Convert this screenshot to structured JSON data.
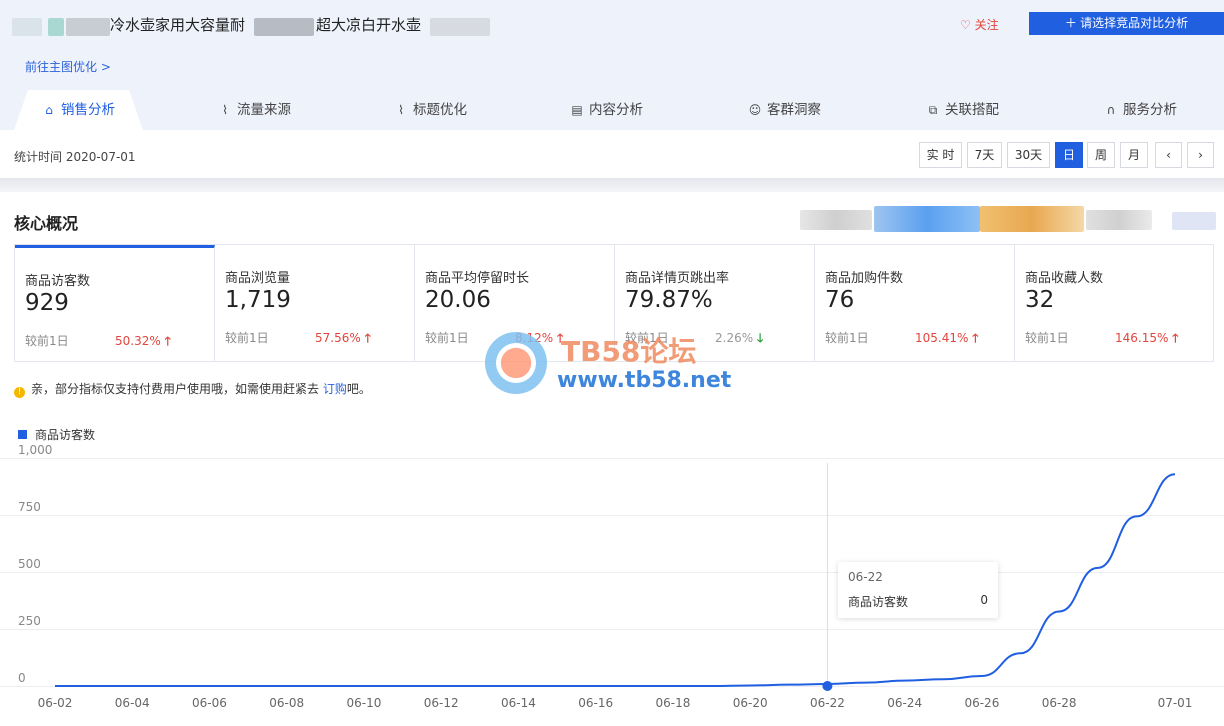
{
  "header": {
    "product_title_part1": "冷水壶家用大容量耐",
    "product_title_part2": "超大凉白开水壶",
    "follow_label": "关注",
    "compare_button_label": "请选择竞品对比分析",
    "goto_link": "前往主图优化 >"
  },
  "tabs": [
    {
      "label": "销售分析",
      "icon": "bag-icon"
    },
    {
      "label": "流量来源",
      "icon": "line-chart-icon"
    },
    {
      "label": "标题优化",
      "icon": "line-chart-icon"
    },
    {
      "label": "内容分析",
      "icon": "document-icon"
    },
    {
      "label": "客群洞察",
      "icon": "users-icon"
    },
    {
      "label": "关联搭配",
      "icon": "link-icon"
    },
    {
      "label": "服务分析",
      "icon": "headset-icon"
    }
  ],
  "stat_time": "统计时间 2020-07-01",
  "period_buttons": [
    "实 时",
    "7天",
    "30天",
    "日",
    "周",
    "月"
  ],
  "active_period": "日",
  "core_title": "核心概况",
  "cards": [
    {
      "label": "商品访客数",
      "value": "929",
      "compare": "较前1日",
      "pct": "50.32%",
      "dir": "up"
    },
    {
      "label": "商品浏览量",
      "value": "1,719",
      "compare": "较前1日",
      "pct": "57.56%",
      "dir": "up"
    },
    {
      "label": "商品平均停留时长",
      "value": "20.06",
      "compare": "较前1日",
      "pct": "8.12%",
      "dir": "up"
    },
    {
      "label": "商品详情页跳出率",
      "value": "79.87%",
      "compare": "较前1日",
      "pct": "2.26%",
      "dir": "down"
    },
    {
      "label": "商品加购件数",
      "value": "76",
      "compare": "较前1日",
      "pct": "105.41%",
      "dir": "up"
    },
    {
      "label": "商品收藏人数",
      "value": "32",
      "compare": "较前1日",
      "pct": "146.15%",
      "dir": "up"
    }
  ],
  "notice": {
    "text": "亲，部分指标仅支持付费用户使用哦，如需使用赶紧去 ",
    "link": "订购",
    "suffix": "吧。"
  },
  "tooltip": {
    "date": "06-22",
    "label": "商品访客数",
    "value": "0"
  },
  "watermark": {
    "line1": "TB58论坛",
    "line2": "www.tb58.net"
  },
  "chart_data": {
    "type": "line",
    "series": [
      {
        "name": "商品访客数",
        "values": [
          0,
          0,
          0,
          0,
          0,
          0,
          0,
          0,
          0,
          0,
          0,
          0,
          0,
          0,
          0,
          0,
          0,
          0,
          0,
          0,
          0,
          2,
          5,
          8,
          10,
          18,
          25,
          30,
          35,
          100,
          240,
          420,
          570,
          780,
          929
        ]
      }
    ],
    "x": [
      "06-02",
      "06-03",
      "06-04",
      "06-05",
      "06-06",
      "06-07",
      "06-08",
      "06-09",
      "06-10",
      "06-11",
      "06-12",
      "06-13",
      "06-14",
      "06-15",
      "06-16",
      "06-17",
      "06-18",
      "06-19",
      "06-20",
      "06-21",
      "06-22",
      "06-23",
      "06-24",
      "06-25",
      "06-26",
      "06-27",
      "06-28",
      "06-29",
      "06-30",
      "07-01"
    ],
    "xticks": [
      "06-02",
      "06-04",
      "06-06",
      "06-08",
      "06-10",
      "06-12",
      "06-14",
      "06-16",
      "06-18",
      "06-20",
      "06-22",
      "06-24",
      "06-26",
      "06-28",
      "07-01"
    ],
    "yticks": [
      "1,000",
      "750",
      "500",
      "250",
      "0"
    ],
    "ylim": [
      0,
      1000
    ],
    "highlight": "06-22",
    "color": "#1f5fe0"
  }
}
